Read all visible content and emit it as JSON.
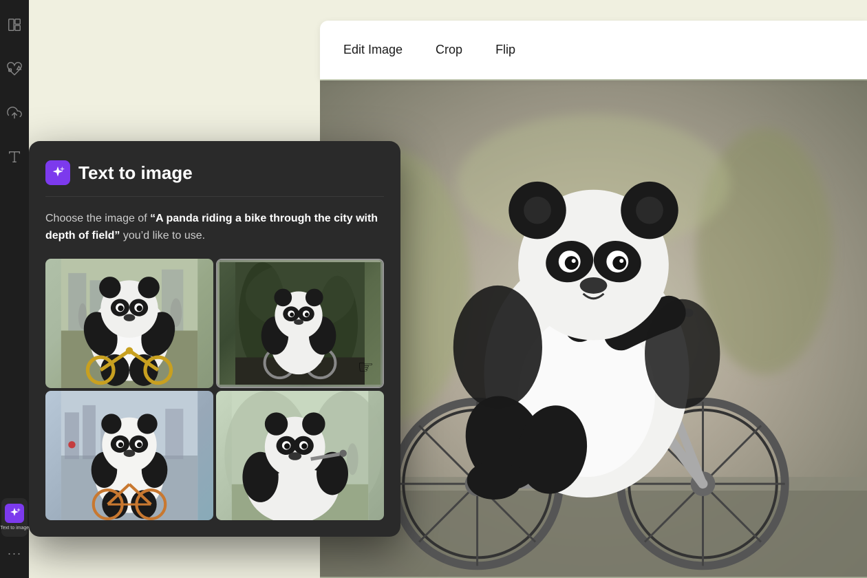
{
  "toolbar": {
    "edit_image_label": "Edit Image",
    "crop_label": "Crop",
    "flip_label": "Flip"
  },
  "sidebar": {
    "icons": [
      {
        "name": "layout-icon",
        "label": "Layout"
      },
      {
        "name": "elements-icon",
        "label": "Elements"
      },
      {
        "name": "upload-icon",
        "label": "Upload"
      },
      {
        "name": "text-icon",
        "label": "Text"
      }
    ],
    "text_to_image": {
      "label": "Text to image"
    },
    "more_label": "..."
  },
  "panel": {
    "title": "Text to image",
    "description_prefix": "Choose the image of ",
    "description_quote": "“A panda riding a bike through the city with depth of field”",
    "description_suffix": " you’d like to use.",
    "images": [
      {
        "id": 1,
        "alt": "Panda on bike street scene",
        "style": "street"
      },
      {
        "id": 2,
        "alt": "Panda sitting on small bike",
        "style": "sitting",
        "selected": true
      },
      {
        "id": 3,
        "alt": "Cartoon panda on bike city",
        "style": "cartoon"
      },
      {
        "id": 4,
        "alt": "Panda close up on bike",
        "style": "closeup"
      }
    ]
  },
  "main_image": {
    "alt": "3D panda riding bicycle"
  },
  "colors": {
    "sidebar_bg": "#1e1e1e",
    "panel_bg": "#2a2a2a",
    "accent_purple": "#7c3aed",
    "toolbar_bg": "#ffffff",
    "canvas_bg": "#f0f0e0"
  }
}
